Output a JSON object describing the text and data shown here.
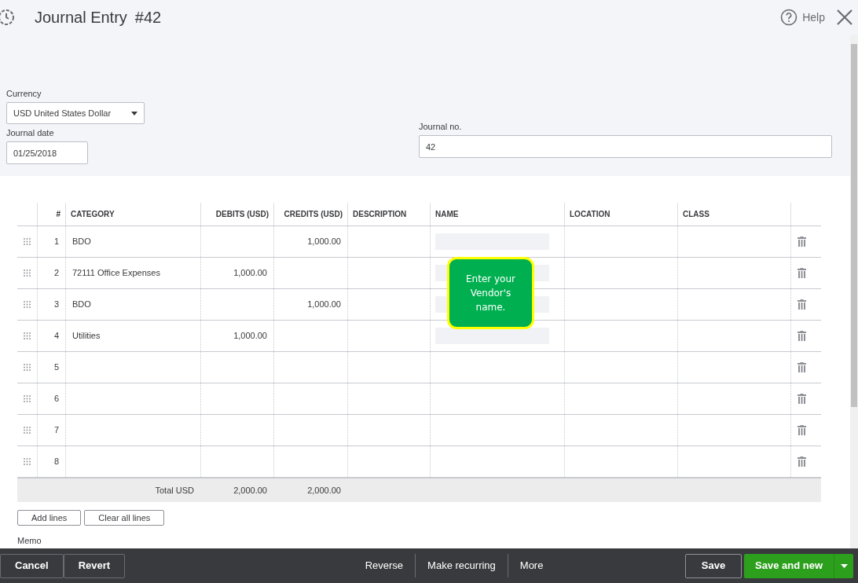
{
  "title": "Journal Entry",
  "number": "#42",
  "help": "Help",
  "currency": {
    "label": "Currency",
    "value": "USD United States Dollar"
  },
  "journal_date": {
    "label": "Journal date",
    "value": "01/25/2018"
  },
  "journal_no": {
    "label": "Journal no.",
    "value": "42"
  },
  "table": {
    "columns": [
      "#",
      "CATEGORY",
      "DEBITS (USD)",
      "CREDITS (USD)",
      "DESCRIPTION",
      "NAME",
      "LOCATION",
      "CLASS"
    ],
    "rows": [
      {
        "no": "1",
        "category": "BDO",
        "debit": "",
        "credit": "1,000.00",
        "name_masked": true
      },
      {
        "no": "2",
        "category": "72111 Office Expenses",
        "debit": "1,000.00",
        "credit": "",
        "name_masked": true
      },
      {
        "no": "3",
        "category": "BDO",
        "debit": "",
        "credit": "1,000.00",
        "name_masked": true
      },
      {
        "no": "4",
        "category": "Utilities",
        "debit": "1,000.00",
        "credit": "",
        "name_masked": true
      },
      {
        "no": "5",
        "category": "",
        "debit": "",
        "credit": "",
        "name_masked": false
      },
      {
        "no": "6",
        "category": "",
        "debit": "",
        "credit": "",
        "name_masked": false
      },
      {
        "no": "7",
        "category": "",
        "debit": "",
        "credit": "",
        "name_masked": false
      },
      {
        "no": "8",
        "category": "",
        "debit": "",
        "credit": "",
        "name_masked": false
      }
    ],
    "total": {
      "label": "Total USD",
      "debit": "2,000.00",
      "credit": "2,000.00"
    }
  },
  "table_buttons": [
    "Add lines",
    "Clear all lines"
  ],
  "memo_label": "Memo",
  "callout": "Enter your Vendor's name.",
  "footer": {
    "left": [
      "Cancel",
      "Revert"
    ],
    "middle": [
      "Reverse",
      "Make recurring",
      "More"
    ],
    "save": "Save",
    "save_new": "Save and new"
  }
}
